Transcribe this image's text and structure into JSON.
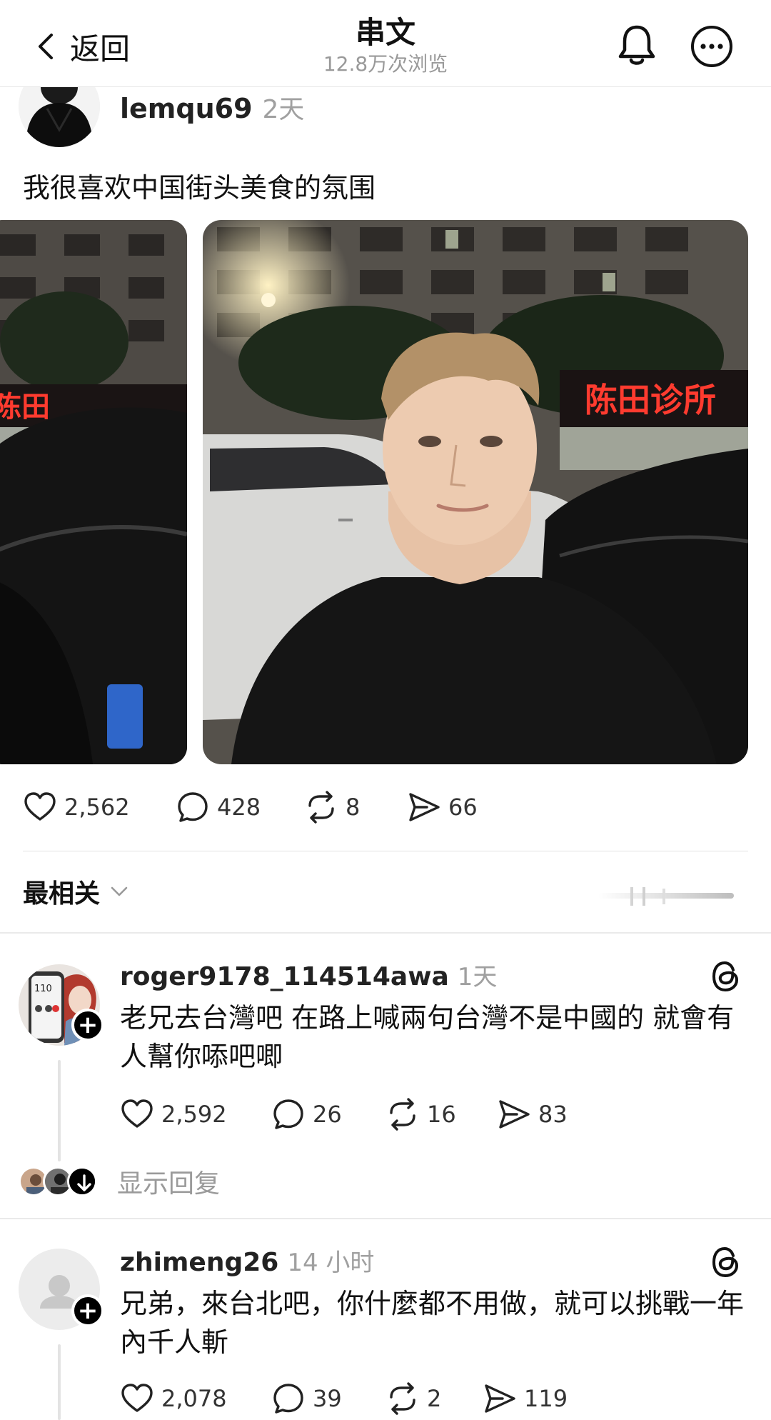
{
  "header": {
    "back_label": "返回",
    "title": "串文",
    "views": "12.8万次浏览"
  },
  "post": {
    "author": "lemqu69",
    "time": "2天",
    "text": "我很喜欢中国街头美食的氛围",
    "stats": {
      "likes": "2,562",
      "comments": "428",
      "reposts": "8",
      "shares": "66"
    },
    "sign_text": "陈田诊所"
  },
  "sort": {
    "label": "最相关"
  },
  "replies": [
    {
      "username": "roger9178_114514awa",
      "time": "1天",
      "text": "老兄去台灣吧 在路上喊兩句台灣不是中國的 就會有人幫你㖭吧唧",
      "likes": "2,592",
      "comments": "26",
      "reposts": "16",
      "shares": "83",
      "phone_badge": "110"
    },
    {
      "username": "zhimeng26",
      "time": "14 小时",
      "text": "兄弟，來台北吧，你什麼都不用做，就可以挑戰一年內千人斬",
      "likes": "2,078",
      "comments": "39",
      "reposts": "2",
      "shares": "119"
    }
  ],
  "show_replies_label": "显示回复",
  "colors": {
    "text": "#111111",
    "muted": "#a0a0a0",
    "divider": "#e2e2e2",
    "neon_sign": "#ff3b2f"
  },
  "icons": [
    "chevron-left-icon",
    "bell-icon",
    "more-icon",
    "heart-icon",
    "comment-icon",
    "repost-icon",
    "share-icon",
    "chevron-down-icon",
    "threads-logo-icon",
    "plus-icon",
    "arrow-down-icon",
    "person-icon"
  ]
}
